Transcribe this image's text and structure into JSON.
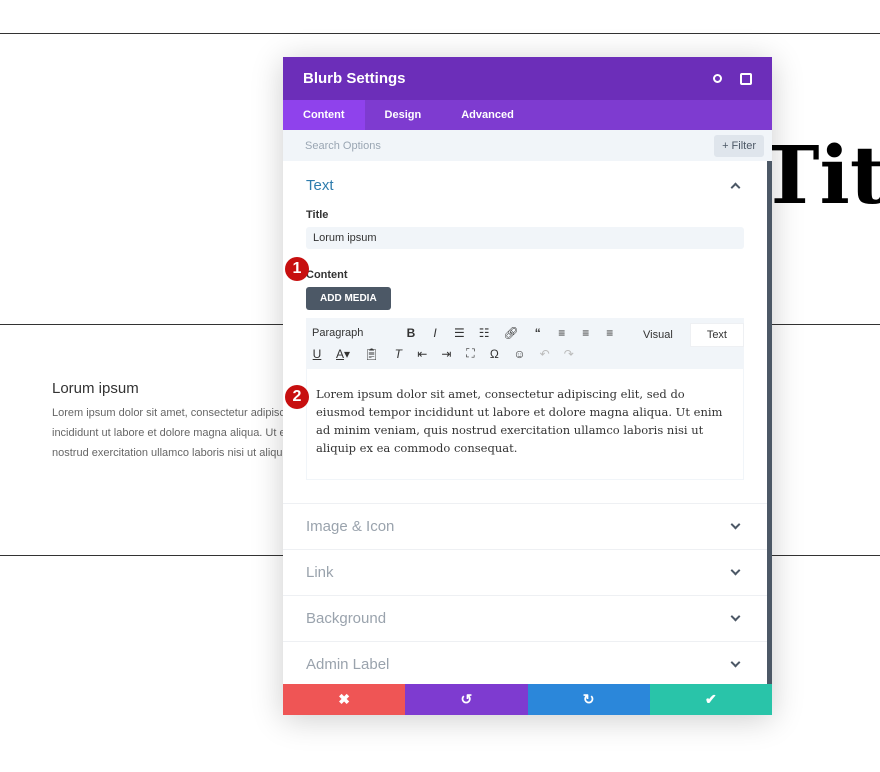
{
  "background": {
    "title_fragment": "Titl",
    "blurb_title": "Lorum ipsum",
    "blurb_lines": [
      "Lorem ipsum dolor sit amet, consectetur adipiscing",
      "incididunt ut labore et dolore magna aliqua. Ut enim",
      "nostrud exercitation ullamco laboris nisi ut aliquip"
    ]
  },
  "modal": {
    "title": "Blurb Settings",
    "icons": [
      "focus-icon",
      "sidebar-layout-icon"
    ],
    "tabs": [
      "Content",
      "Design",
      "Advanced"
    ],
    "active_tab": "Content",
    "search_placeholder": "Search Options",
    "filter_label": "+ Filter",
    "text_section": {
      "heading": "Text",
      "title_label": "Title",
      "title_value": "Lorum ipsum",
      "content_label": "Content",
      "add_media": "ADD MEDIA",
      "editor_tabs": [
        "Visual",
        "Text"
      ],
      "active_editor_tab": "Visual",
      "format_select": "Paragraph",
      "content": "Lorem ipsum dolor sit amet, consectetur adipiscing elit, sed do eiusmod tempor incididunt ut labore et dolore magna aliqua. Ut enim ad minim veniam, quis nostrud exercitation ullamco laboris nisi ut aliquip ex ea commodo consequat."
    },
    "badges": [
      "1",
      "2"
    ],
    "sections": [
      "Image & Icon",
      "Link",
      "Background",
      "Admin Label"
    ],
    "footer": {
      "colors": [
        "#ef5555",
        "#7e3bd0",
        "#2b87da",
        "#29c4a9"
      ]
    }
  }
}
